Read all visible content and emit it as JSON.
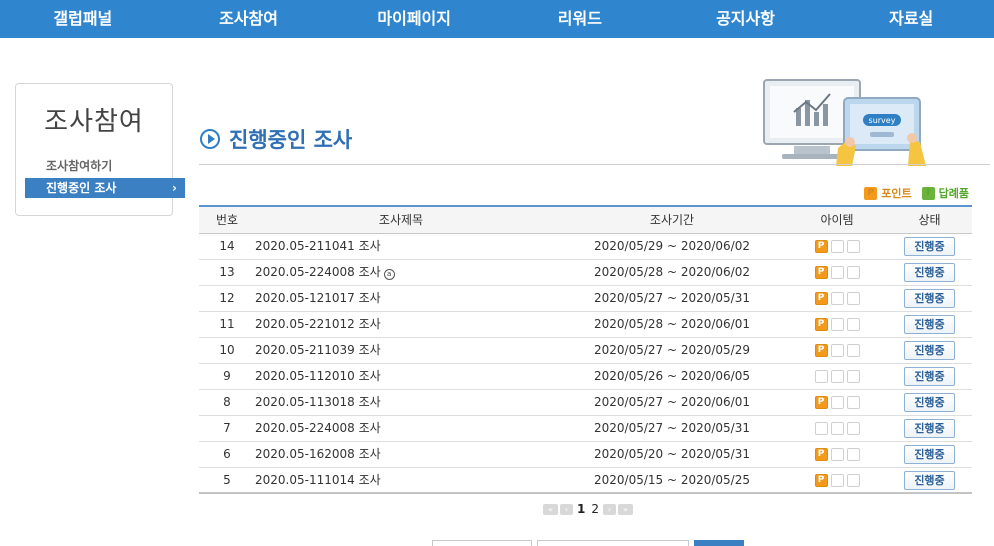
{
  "nav": [
    "갤럽패널",
    "조사참여",
    "마이페이지",
    "리워드",
    "공지사항",
    "자료실"
  ],
  "sidebar": {
    "title": "조사참여",
    "items": [
      {
        "label": "조사참여하기"
      },
      {
        "label": "진행중인 조사",
        "chevron": "›"
      }
    ]
  },
  "page": {
    "title": "진행중인 조사",
    "illustration_text": "survey"
  },
  "legend": {
    "point_badge": "P",
    "point_label": "포인트",
    "gift_badge": "I",
    "gift_label": "답례품"
  },
  "table": {
    "headers": {
      "num": "번호",
      "title": "조사제목",
      "period": "조사기간",
      "item": "아이템",
      "status": "상태"
    },
    "rows": [
      {
        "num": "14",
        "title": "2020.05-211041 조사",
        "extra": "",
        "period": "2020/05/29 ~ 2020/06/02",
        "point": "P",
        "status": "진행중"
      },
      {
        "num": "13",
        "title": "2020.05-224008 조사",
        "extra": "a",
        "period": "2020/05/28 ~ 2020/06/02",
        "point": "P",
        "status": "진행중"
      },
      {
        "num": "12",
        "title": "2020.05-121017 조사",
        "extra": "",
        "period": "2020/05/27 ~ 2020/05/31",
        "point": "P",
        "status": "진행중"
      },
      {
        "num": "11",
        "title": "2020.05-221012 조사",
        "extra": "",
        "period": "2020/05/28 ~ 2020/06/01",
        "point": "P",
        "status": "진행중"
      },
      {
        "num": "10",
        "title": "2020.05-211039 조사",
        "extra": "",
        "period": "2020/05/27 ~ 2020/05/29",
        "point": "P",
        "status": "진행중"
      },
      {
        "num": "9",
        "title": "2020.05-112010 조사",
        "extra": "",
        "period": "2020/05/26 ~ 2020/06/05",
        "point": "",
        "status": "진행중"
      },
      {
        "num": "8",
        "title": "2020.05-113018 조사",
        "extra": "",
        "period": "2020/05/27 ~ 2020/06/01",
        "point": "P",
        "status": "진행중"
      },
      {
        "num": "7",
        "title": "2020.05-224008 조사",
        "extra": "",
        "period": "2020/05/27 ~ 2020/05/31",
        "point": "",
        "status": "진행중"
      },
      {
        "num": "6",
        "title": "2020.05-162008 조사",
        "extra": "",
        "period": "2020/05/20 ~ 2020/05/31",
        "point": "P",
        "status": "진행중"
      },
      {
        "num": "5",
        "title": "2020.05-111014 조사",
        "extra": "",
        "period": "2020/05/15 ~ 2020/05/25",
        "point": "P",
        "status": "진행중"
      }
    ]
  },
  "pagination": {
    "first": "«",
    "prev": "‹",
    "pages": [
      "1",
      "2"
    ],
    "current": "1",
    "next": "›",
    "last": "»"
  },
  "colors": {
    "nav_bg": "#2f86cf",
    "active_sidebar": "#3a80c2",
    "title": "#2f6fb5",
    "point_badge": "#f39a1c",
    "gift_badge": "#6bb33a"
  }
}
